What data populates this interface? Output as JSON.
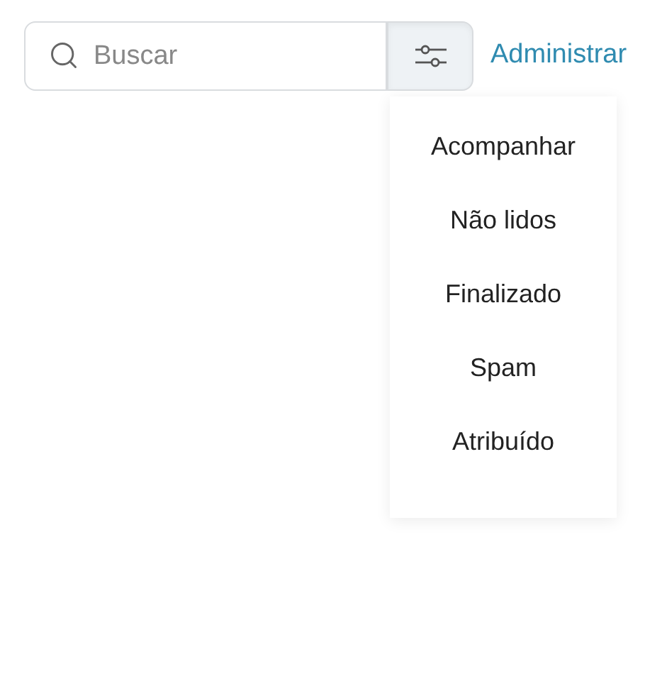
{
  "search": {
    "placeholder": "Buscar"
  },
  "manage_link": "Administrar",
  "filter_menu": {
    "expanded": true,
    "items": [
      {
        "label": "Acompanhar"
      },
      {
        "label": "Não lidos"
      },
      {
        "label": "Finalizado"
      },
      {
        "label": "Spam"
      },
      {
        "label": "Atribuído"
      }
    ]
  }
}
